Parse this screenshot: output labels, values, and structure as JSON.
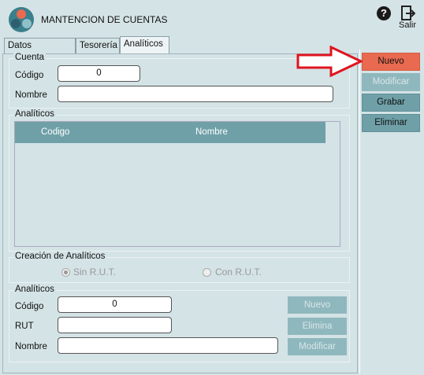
{
  "app": {
    "title": "MANTENCION DE CUENTAS",
    "exit_label": "Salir",
    "help_symbol": "?"
  },
  "tabs": [
    {
      "label": "Datos Generales"
    },
    {
      "label": "Tesorería"
    },
    {
      "label": "Analíticos"
    }
  ],
  "cuenta": {
    "group_label": "Cuenta",
    "codigo_label": "Código",
    "codigo_value": "0",
    "nombre_label": "Nombre",
    "nombre_value": ""
  },
  "analiticos_grid": {
    "group_label": "Analíticos",
    "columns": [
      "Codigo",
      "Nombre"
    ],
    "rows": []
  },
  "creacion": {
    "group_label": "Creación de Analíticos",
    "options": [
      {
        "label": "Sin R.U.T.",
        "selected": true
      },
      {
        "label": "Con R.U.T.",
        "selected": false
      }
    ]
  },
  "analitico_form": {
    "group_label": "Analíticos",
    "codigo_label": "Código",
    "codigo_value": "0",
    "rut_label": "RUT",
    "rut_value": "",
    "nombre_label": "Nombre",
    "nombre_value": "",
    "buttons": {
      "nuevo": "Nuevo",
      "elimina": "Elimina",
      "modificar": "Modificar"
    }
  },
  "actions": {
    "nuevo": "Nuevo",
    "modificar": "Modificar",
    "grabar": "Grabar",
    "eliminar": "Eliminar"
  },
  "colors": {
    "accent": "#6fa0a8",
    "highlight": "#e86a50",
    "arrow": "#e0141e",
    "background": "#d4e3e6"
  }
}
